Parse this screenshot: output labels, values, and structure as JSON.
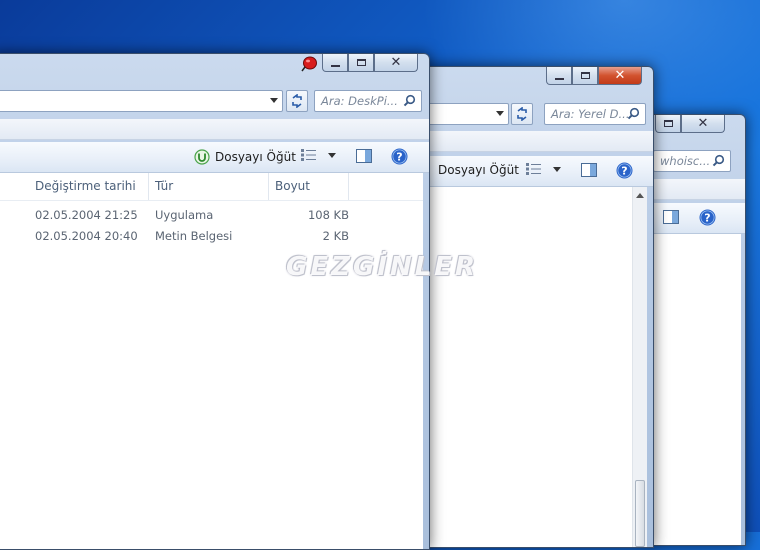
{
  "desktop": {
    "watermark": "GEZGİNLER"
  },
  "window_front": {
    "search_placeholder": "Ara: DeskPi...",
    "toolbar": {
      "suggest_label": "Dosyayı Öğüt"
    },
    "columns": [
      "Değiştirme tarihi",
      "Tür",
      "Boyut"
    ],
    "rows": [
      {
        "date": "02.05.2004 21:25",
        "type": "Uygulama",
        "size": "108 KB"
      },
      {
        "date": "02.05.2004 20:40",
        "type": "Metin Belgesi",
        "size": "2 KB"
      }
    ]
  },
  "window_middle": {
    "search_placeholder": "Ara: Yerel D...",
    "toolbar": {
      "suggest_label": "Dosyayı Öğüt"
    }
  },
  "window_back": {
    "search_placeholder": "whoisc..."
  },
  "colors": {
    "close_active": "#c23a18",
    "suggest_icon": "#4aa34a",
    "help_icon": "#2a63c9"
  }
}
